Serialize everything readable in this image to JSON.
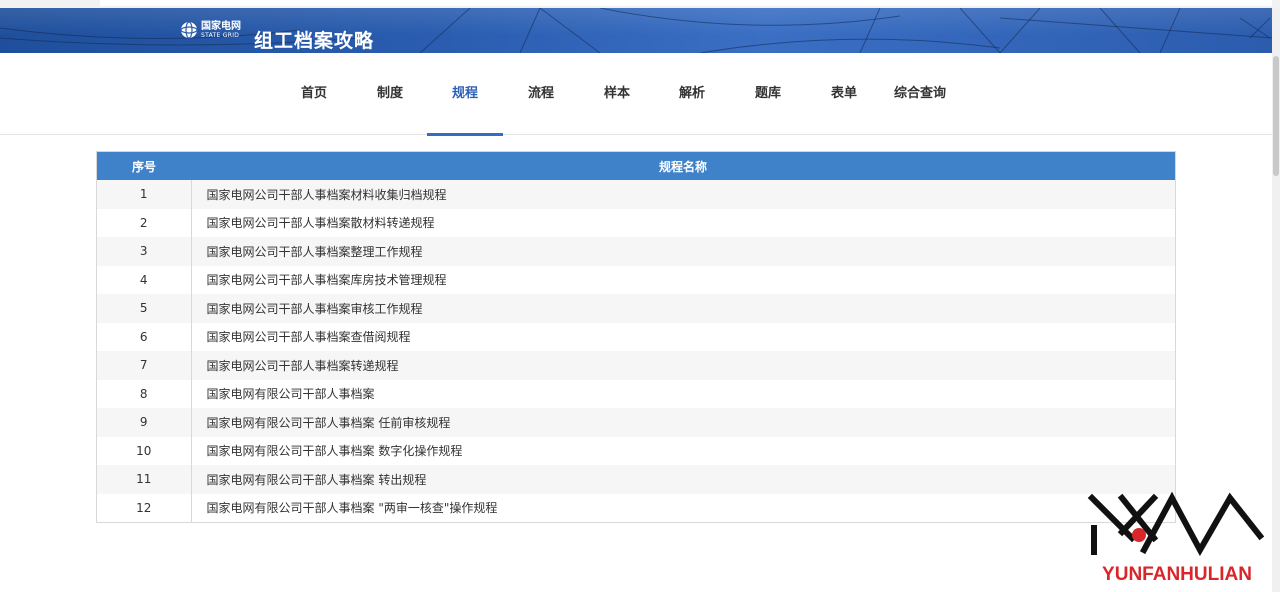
{
  "header": {
    "logo_cn": "国家电网",
    "logo_en": "STATE GRID",
    "site_title": "组工档案攻略"
  },
  "nav": {
    "tabs": [
      {
        "label": "首页"
      },
      {
        "label": "制度"
      },
      {
        "label": "规程",
        "active": true
      },
      {
        "label": "流程"
      },
      {
        "label": "样本"
      },
      {
        "label": "解析"
      },
      {
        "label": "题库"
      },
      {
        "label": "表单"
      },
      {
        "label": "综合查询"
      }
    ]
  },
  "table": {
    "headers": [
      "序号",
      "规程名称"
    ],
    "rows": [
      {
        "no": "1",
        "name": "国家电网公司干部人事档案材料收集归档规程"
      },
      {
        "no": "2",
        "name": "国家电网公司干部人事档案散材料转递规程"
      },
      {
        "no": "3",
        "name": "国家电网公司干部人事档案整理工作规程"
      },
      {
        "no": "4",
        "name": "国家电网公司干部人事档案库房技术管理规程"
      },
      {
        "no": "5",
        "name": "国家电网公司干部人事档案审核工作规程"
      },
      {
        "no": "6",
        "name": "国家电网公司干部人事档案查借阅规程"
      },
      {
        "no": "7",
        "name": "国家电网公司干部人事档案转递规程"
      },
      {
        "no": "8",
        "name": "国家电网有限公司干部人事档案"
      },
      {
        "no": "9",
        "name": "国家电网有限公司干部人事档案 任前审核规程"
      },
      {
        "no": "10",
        "name": "国家电网有限公司干部人事档案 数字化操作规程"
      },
      {
        "no": "11",
        "name": "国家电网有限公司干部人事档案 转出规程"
      },
      {
        "no": "12",
        "name": "国家电网有限公司干部人事档案 \"两审一核查\"操作规程"
      }
    ]
  },
  "watermark": {
    "text": "YUNFANHULIAN",
    "icon": "yunfan-logo-icon"
  },
  "colors": {
    "banner": "#2a5db0",
    "accent": "#2f6ec5",
    "table_header": "#3f82c9",
    "watermark_red": "#d8262b"
  }
}
